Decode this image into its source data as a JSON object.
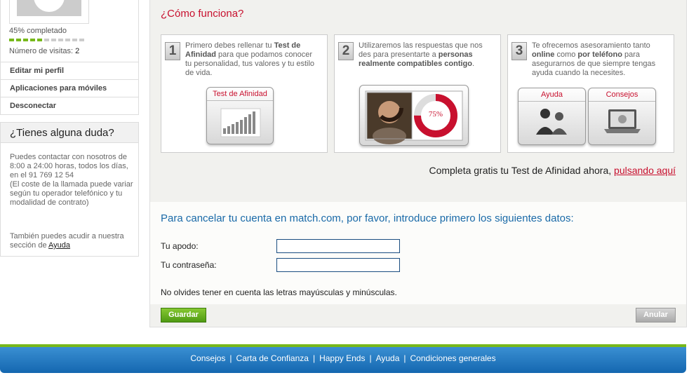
{
  "profile": {
    "progress_text": "45% completado",
    "progress_value": 0.45,
    "progress_segments_filled": 5,
    "progress_segments_total": 11,
    "visits_label": "Número de visitas:",
    "visits_count": "2"
  },
  "sidebar": {
    "menu": [
      {
        "label": "Editar mi perfil"
      },
      {
        "label": "Aplicaciones para móviles"
      },
      {
        "label": "Desconectar"
      }
    ],
    "help": {
      "title": "¿Tienes alguna duda?",
      "text": "Puedes contactar con nosotros de 8:00 a 24:00 horas, todos los días, en el 91 769 12 54\n(El coste de la llamada puede variar según tu operador telefónico y tu modalidad de contrato)",
      "text2": "También puedes acudir a nuestra sección de",
      "link": "Ayuda"
    }
  },
  "how": {
    "title": "¿Cómo funciona?",
    "steps": [
      {
        "number": "1",
        "t1": "Primero debes rellenar tu ",
        "b1": "Test de Afinidad",
        "t2": " para que podamos conocer tu personalidad, tus valores y tu estilo de vida.",
        "card_label": "Test de Afinidad"
      },
      {
        "number": "2",
        "t1": "Utilizaremos las respuestas que nos des para presentarte a ",
        "b1": "personas realmente compatibles contigo",
        "t2": ".",
        "percent": "75%",
        "percent_value": 0.75
      },
      {
        "number": "3",
        "t1": "Te ofrecemos asesoramiento tanto ",
        "b1": "online",
        "t2": " como ",
        "b2": "por teléfono",
        "t3": " para asegurarnos de que siempre tengas ayuda cuando la necesites.",
        "cards": [
          "Ayuda",
          "Consejos"
        ]
      }
    ],
    "cta_text": "Completa gratis tu Test de Afinidad ahora, ",
    "cta_link": "pulsando aquí"
  },
  "cancel": {
    "title": "Para cancelar tu cuenta en match.com, por favor, introduce primero los siguientes datos:",
    "nickname_label": "Tu apodo:",
    "nickname_value": "",
    "password_label": "Tu contraseña:",
    "password_value": "",
    "note": "No olvides tener en cuenta las letras mayúsculas y minúsculas.",
    "save_label": "Guardar",
    "cancel_label": "Anular"
  },
  "footer": {
    "links": [
      "Consejos",
      "Carta de Confianza",
      "Happy Ends",
      "Ayuda",
      "Condiciones generales"
    ],
    "separator": "|"
  },
  "colors": {
    "accent_red": "#c8102e",
    "link_blue": "#1a6aa8",
    "progress_green": "#77b81a",
    "footer_blue": "#1467b0"
  }
}
